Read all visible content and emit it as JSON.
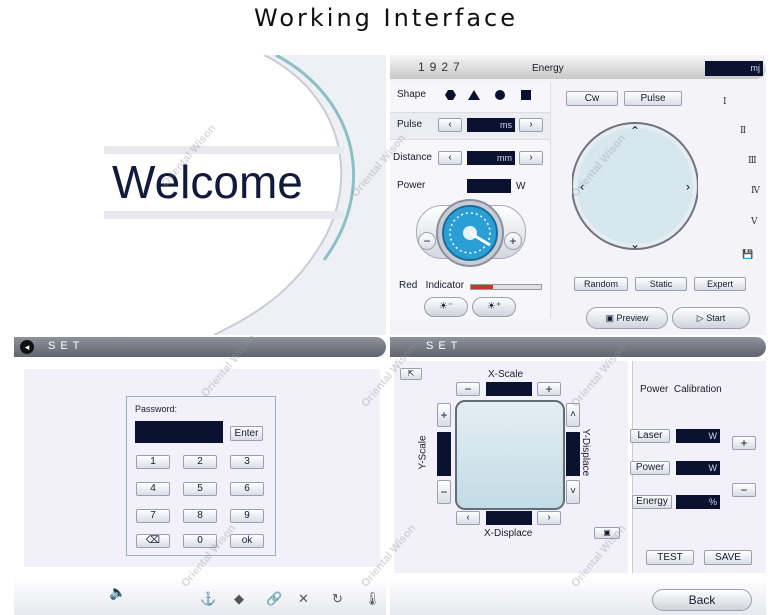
{
  "page_title": "Working Interface",
  "welcome": {
    "text": "Welcome"
  },
  "working": {
    "model": "1927",
    "energy_label": "Energy",
    "energy_unit": "mj",
    "shape_label": "Shape",
    "pulse_label": "Pulse",
    "pulse_unit": "ms",
    "distance_label": "Distance",
    "distance_unit": "mm",
    "power_label": "Power",
    "power_unit": "W",
    "red_indicator_label": "Red   Indicator",
    "mode_cw": "Cw",
    "mode_pulse": "Pulse",
    "levels": [
      "Ⅰ",
      "Ⅱ",
      "Ⅲ",
      "Ⅳ",
      "Ⅴ"
    ],
    "random_label": "Random",
    "static_label": "Static",
    "expert_label": "Expert",
    "preview_label": "Preview",
    "start_label": "Start",
    "minus": "−",
    "plus": "+",
    "bright_down": "☀⁻",
    "bright_up": "☀⁺"
  },
  "set_password": {
    "bar_title": "SET",
    "password_label": "Password:",
    "enter_label": "Enter",
    "keys": [
      "1",
      "2",
      "3",
      "4",
      "5",
      "6",
      "7",
      "8",
      "9",
      "⌫",
      "0",
      "ok"
    ]
  },
  "set_calibration": {
    "bar_title": "SET",
    "x_scale": "X-Scale",
    "y_scale": "Y-Scale",
    "x_displace": "X-Displace",
    "y_displace": "Y-Displace",
    "power_calibration": "Power  Calibration",
    "laser_label": "Laser",
    "laser_unit": "W",
    "power_label": "Power",
    "power_unit": "W",
    "energy_label": "Energy",
    "energy_unit": "%",
    "test_label": "TEST",
    "save_label": "SAVE",
    "back_label": "Back",
    "plus": "+",
    "minus": "−"
  },
  "watermark": "Oriental Wison",
  "colors": {
    "dark_field": "#0b1230",
    "bar": "#6e737c",
    "bg_panel": "#f2f1fa"
  }
}
